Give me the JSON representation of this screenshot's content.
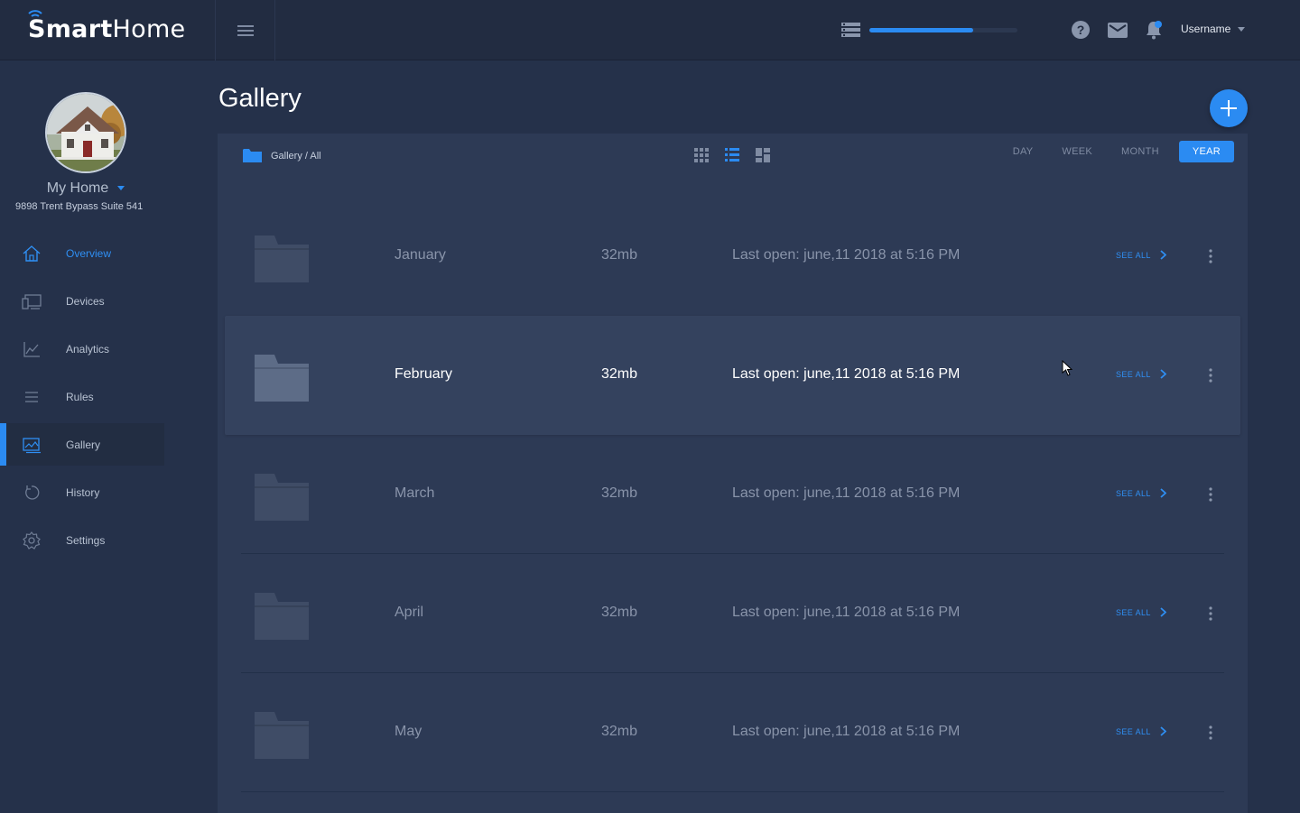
{
  "brand": {
    "name_bold": "Smart",
    "name_light": "Home"
  },
  "topbar": {
    "storage_progress": 0.7,
    "username": "Username"
  },
  "sidebar": {
    "home_name": "My Home",
    "address": "9898 Trent Bypass Suite 541",
    "items": [
      {
        "label": "Overview",
        "icon": "home-icon"
      },
      {
        "label": "Devices",
        "icon": "devices-icon"
      },
      {
        "label": "Analytics",
        "icon": "analytics-icon"
      },
      {
        "label": "Rules",
        "icon": "rules-icon"
      },
      {
        "label": "Gallery",
        "icon": "gallery-icon"
      },
      {
        "label": "History",
        "icon": "history-icon"
      },
      {
        "label": "Settings",
        "icon": "gear-icon"
      }
    ]
  },
  "main": {
    "title": "Gallery",
    "breadcrumb": "Gallery / All",
    "ranges": [
      "DAY",
      "WEEK",
      "MONTH",
      "YEAR"
    ],
    "active_range": "YEAR",
    "see_all_label": "SEE ALL",
    "folders": [
      {
        "name": "January",
        "size": "32mb",
        "last_open": "Last open: june,11 2018 at 5:16 PM"
      },
      {
        "name": "February",
        "size": "32mb",
        "last_open": "Last open: june,11 2018 at 5:16 PM"
      },
      {
        "name": "March",
        "size": "32mb",
        "last_open": "Last open: june,11 2018 at 5:16 PM"
      },
      {
        "name": "April",
        "size": "32mb",
        "last_open": "Last open: june,11 2018 at 5:16 PM"
      },
      {
        "name": "May",
        "size": "32mb",
        "last_open": "Last open: june,11 2018 at 5:16 PM"
      }
    ]
  },
  "colors": {
    "accent": "#2b8bf2",
    "background": "#25314a",
    "panel": "#2d3a55"
  }
}
